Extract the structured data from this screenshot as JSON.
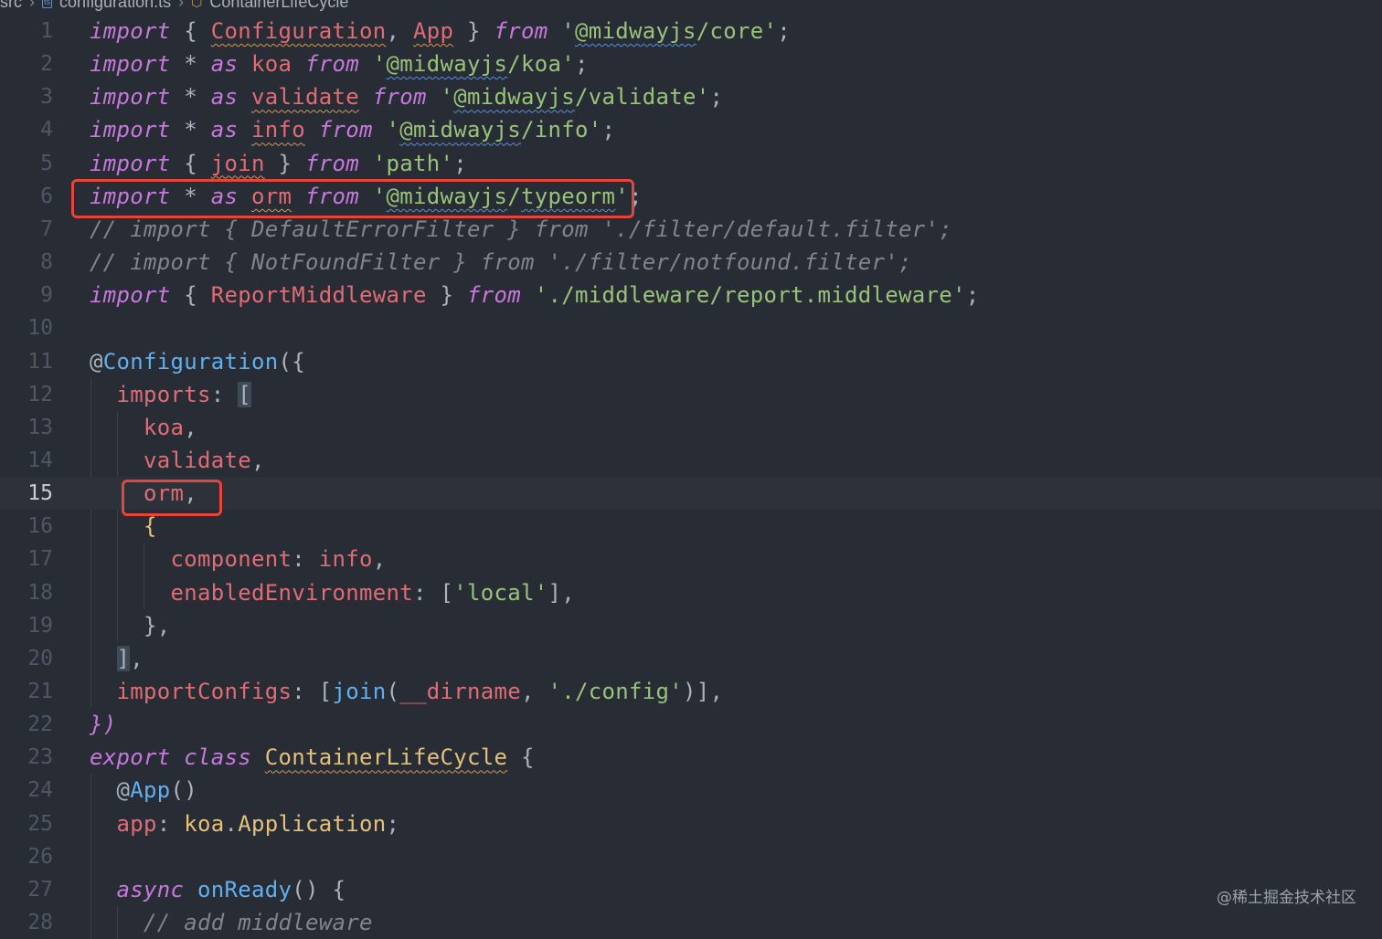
{
  "breadcrumb": {
    "folder": "src",
    "file": "configuration.ts",
    "file_icon": "ts",
    "symbol": "ContainerLifeCycle"
  },
  "editor": {
    "current_line": "15",
    "line_numbers": [
      "1",
      "2",
      "3",
      "4",
      "5",
      "6",
      "7",
      "8",
      "9",
      "10",
      "11",
      "12",
      "13",
      "14",
      "15",
      "16",
      "17",
      "18",
      "19",
      "20",
      "21",
      "22",
      "23",
      "24",
      "25",
      "26",
      "27",
      "28"
    ],
    "lines": [
      [
        {
          "t": "import",
          "c": "kw"
        },
        {
          "t": " { "
        },
        {
          "t": "Configuration",
          "c": "id wavy"
        },
        {
          "t": ", "
        },
        {
          "t": "App",
          "c": "id wavy"
        },
        {
          "t": " } "
        },
        {
          "t": "from",
          "c": "kw"
        },
        {
          "t": " '"
        },
        {
          "t": "@midwayjs",
          "c": "str wavyb"
        },
        {
          "t": "/core'",
          "c": "str"
        },
        {
          "t": ";"
        }
      ],
      [
        {
          "t": "import",
          "c": "kw"
        },
        {
          "t": " * "
        },
        {
          "t": "as",
          "c": "kw"
        },
        {
          "t": " koa ",
          "c": "id"
        },
        {
          "t": "from",
          "c": "kw"
        },
        {
          "t": " '",
          "c": "str"
        },
        {
          "t": "@midwayjs",
          "c": "str wavyb"
        },
        {
          "t": "/koa'",
          "c": "str"
        },
        {
          "t": ";"
        }
      ],
      [
        {
          "t": "import",
          "c": "kw"
        },
        {
          "t": " * "
        },
        {
          "t": "as",
          "c": "kw"
        },
        {
          "t": " "
        },
        {
          "t": "validate",
          "c": "id wavy"
        },
        {
          "t": " "
        },
        {
          "t": "from",
          "c": "kw"
        },
        {
          "t": " '",
          "c": "str"
        },
        {
          "t": "@midwayjs",
          "c": "str wavyb"
        },
        {
          "t": "/validate'",
          "c": "str"
        },
        {
          "t": ";"
        }
      ],
      [
        {
          "t": "import",
          "c": "kw"
        },
        {
          "t": " * "
        },
        {
          "t": "as",
          "c": "kw"
        },
        {
          "t": " "
        },
        {
          "t": "info",
          "c": "id wavy"
        },
        {
          "t": " "
        },
        {
          "t": "from",
          "c": "kw"
        },
        {
          "t": " '",
          "c": "str"
        },
        {
          "t": "@midwayjs",
          "c": "str wavyb"
        },
        {
          "t": "/info'",
          "c": "str"
        },
        {
          "t": ";"
        }
      ],
      [
        {
          "t": "import",
          "c": "kw"
        },
        {
          "t": " { "
        },
        {
          "t": "join",
          "c": "id wavy"
        },
        {
          "t": " } "
        },
        {
          "t": "from",
          "c": "kw"
        },
        {
          "t": " 'path'",
          "c": "str"
        },
        {
          "t": ";"
        }
      ],
      [
        {
          "t": "import",
          "c": "kw"
        },
        {
          "t": " * "
        },
        {
          "t": "as",
          "c": "kw"
        },
        {
          "t": " "
        },
        {
          "t": "orm",
          "c": "id wavy"
        },
        {
          "t": " "
        },
        {
          "t": "from",
          "c": "kw"
        },
        {
          "t": " '",
          "c": "str"
        },
        {
          "t": "@midwayjs",
          "c": "str wavyb"
        },
        {
          "t": "/",
          "c": "str"
        },
        {
          "t": "typeorm",
          "c": "str wavyb"
        },
        {
          "t": "'",
          "c": "str"
        },
        {
          "t": ";"
        }
      ],
      [
        {
          "t": "// import { DefaultErrorFilter } from './filter/default.filter';",
          "c": "cm"
        }
      ],
      [
        {
          "t": "// import { NotFoundFilter } from './filter/notfound.filter';",
          "c": "cm"
        }
      ],
      [
        {
          "t": "import",
          "c": "kw"
        },
        {
          "t": " { "
        },
        {
          "t": "ReportMiddleware",
          "c": "id"
        },
        {
          "t": " } "
        },
        {
          "t": "from",
          "c": "kw"
        },
        {
          "t": " './middleware/report.middleware'",
          "c": "str"
        },
        {
          "t": ";"
        }
      ],
      [],
      [
        {
          "t": "@"
        },
        {
          "t": "Configuration",
          "c": "fn"
        },
        {
          "t": "({"
        }
      ],
      [
        {
          "t": "  "
        },
        {
          "t": "imports",
          "c": "id"
        },
        {
          "t": ": "
        },
        {
          "t": "[",
          "c": "hlbrk"
        }
      ],
      [
        {
          "t": "    "
        },
        {
          "t": "koa",
          "c": "id"
        },
        {
          "t": ","
        }
      ],
      [
        {
          "t": "    "
        },
        {
          "t": "validate",
          "c": "id"
        },
        {
          "t": ","
        }
      ],
      [
        {
          "t": "    "
        },
        {
          "t": "orm",
          "c": "id"
        },
        {
          "t": ","
        }
      ],
      [
        {
          "t": "    {",
          "c": "cls"
        }
      ],
      [
        {
          "t": "      "
        },
        {
          "t": "component",
          "c": "id"
        },
        {
          "t": ": "
        },
        {
          "t": "info",
          "c": "id"
        },
        {
          "t": ","
        }
      ],
      [
        {
          "t": "      "
        },
        {
          "t": "enabledEnvironment",
          "c": "id"
        },
        {
          "t": ": ["
        },
        {
          "t": "'local'",
          "c": "str"
        },
        {
          "t": "],"
        }
      ],
      [
        {
          "t": "    },"
        }
      ],
      [
        {
          "t": "  "
        },
        {
          "t": "]",
          "c": "hlbrk"
        },
        {
          "t": ","
        }
      ],
      [
        {
          "t": "  "
        },
        {
          "t": "importConfigs",
          "c": "id"
        },
        {
          "t": ": ["
        },
        {
          "t": "join",
          "c": "fn"
        },
        {
          "t": "("
        },
        {
          "t": "__dirname",
          "c": "id"
        },
        {
          "t": ", "
        },
        {
          "t": "'./config'",
          "c": "str"
        },
        {
          "t": ")],"
        }
      ],
      [
        {
          "t": "})",
          "c": "kw"
        }
      ],
      [
        {
          "t": "export",
          "c": "kw"
        },
        {
          "t": " "
        },
        {
          "t": "class",
          "c": "kw"
        },
        {
          "t": " "
        },
        {
          "t": "ContainerLifeCycle",
          "c": "cls wavy"
        },
        {
          "t": " {"
        }
      ],
      [
        {
          "t": "  @"
        },
        {
          "t": "App",
          "c": "fn"
        },
        {
          "t": "()"
        }
      ],
      [
        {
          "t": "  "
        },
        {
          "t": "app",
          "c": "id"
        },
        {
          "t": ": "
        },
        {
          "t": "koa",
          "c": "cls"
        },
        {
          "t": "."
        },
        {
          "t": "Application",
          "c": "cls"
        },
        {
          "t": ";"
        }
      ],
      [],
      [
        {
          "t": "  "
        },
        {
          "t": "async",
          "c": "kw"
        },
        {
          "t": " "
        },
        {
          "t": "onReady",
          "c": "fn"
        },
        {
          "t": "() {"
        }
      ],
      [
        {
          "t": "    // add middleware",
          "c": "cm"
        }
      ]
    ]
  },
  "watermark": "@稀土掘金技术社区"
}
